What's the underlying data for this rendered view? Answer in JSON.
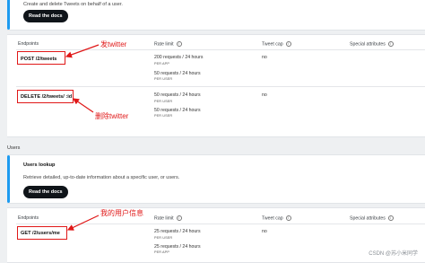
{
  "tweets_panel": {
    "description": "Create and delete Tweets on behalf of a user.",
    "read_docs": "Read the docs"
  },
  "tweets_table": {
    "headers": {
      "endpoints": "Endpoints",
      "rate_limit": "Rate limit",
      "tweet_cap": "Tweet cap",
      "special": "Special attributes"
    },
    "rows": [
      {
        "endpoint": "POST /2/tweets",
        "limit1": "200 requests / 24 hours",
        "scope1": "PER APP",
        "limit2": "50 requests / 24 hours",
        "scope2": "PER USER",
        "cap": "no"
      },
      {
        "endpoint": "DELETE /2/tweets/ :id",
        "limit1": "50 requests / 24 hours",
        "scope1": "PER USER",
        "limit2": "50 requests / 24 hours",
        "scope2": "PER USER",
        "cap": "no"
      }
    ]
  },
  "users_section": {
    "label": "Users",
    "panel_title": "Users lookup",
    "description": "Retrieve detailed, up-to-date information about a specific user, or users.",
    "read_docs": "Read the docs"
  },
  "users_table": {
    "headers": {
      "endpoints": "Endpoints",
      "rate_limit": "Rate limit",
      "tweet_cap": "Tweet cap",
      "special": "Special attributes"
    },
    "rows": [
      {
        "endpoint": "GET /2/users/me",
        "limit1": "25 requests / 24 hours",
        "scope1": "PER USER",
        "limit2": "25 requests / 24 hours",
        "scope2": "PER APP",
        "cap": "no"
      }
    ]
  },
  "annotations": {
    "post": "发twitter",
    "delete": "删除twitter",
    "get_me": "我的用户信息"
  },
  "watermark": "CSDN @苏小米同学",
  "colors": {
    "accent": "#1d9bf0",
    "annotation_red": "#e01818",
    "button_bg": "#0f1419"
  }
}
